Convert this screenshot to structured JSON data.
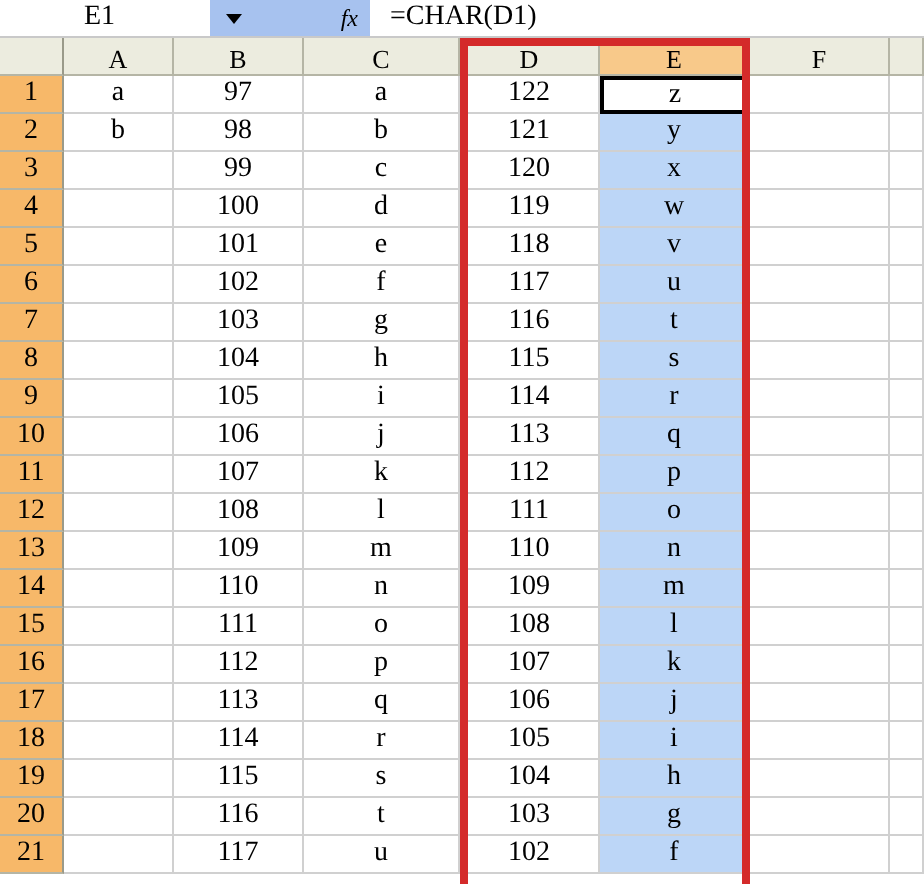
{
  "formula_bar": {
    "name_box": "E1",
    "fx": "fx",
    "formula": "=CHAR(D1)"
  },
  "columns": [
    {
      "label": "A",
      "selected": false,
      "outlined": false
    },
    {
      "label": "B",
      "selected": false,
      "outlined": false
    },
    {
      "label": "C",
      "selected": false,
      "outlined": false
    },
    {
      "label": "D",
      "selected": false,
      "outlined": true
    },
    {
      "label": "E",
      "selected": true,
      "outlined": true
    },
    {
      "label": "F",
      "selected": false,
      "outlined": false
    }
  ],
  "rows": [
    {
      "number": "1",
      "selected": true,
      "cells": [
        {
          "text": "a",
          "selected": false,
          "active": false
        },
        {
          "text": "97",
          "selected": false,
          "active": false
        },
        {
          "text": "a",
          "selected": false,
          "active": false
        },
        {
          "text": "122",
          "selected": false,
          "active": false
        },
        {
          "text": "z",
          "selected": false,
          "active": true
        },
        {
          "selected": false,
          "active": false
        }
      ]
    },
    {
      "number": "2",
      "selected": true,
      "cells": [
        {
          "text": "b",
          "selected": false,
          "active": false
        },
        {
          "text": "98",
          "selected": false,
          "active": false
        },
        {
          "text": "b",
          "selected": false,
          "active": false
        },
        {
          "text": "121",
          "selected": false,
          "active": false
        },
        {
          "text": "y",
          "selected": true,
          "active": false
        },
        {
          "selected": false,
          "active": false
        }
      ]
    },
    {
      "number": "3",
      "selected": true,
      "cells": [
        {
          "selected": false,
          "active": false
        },
        {
          "text": "99",
          "selected": false,
          "active": false
        },
        {
          "text": "c",
          "selected": false,
          "active": false
        },
        {
          "text": "120",
          "selected": false,
          "active": false
        },
        {
          "text": "x",
          "selected": true,
          "active": false
        },
        {
          "selected": false,
          "active": false
        }
      ]
    },
    {
      "number": "4",
      "selected": true,
      "cells": [
        {
          "selected": false,
          "active": false
        },
        {
          "text": "100",
          "selected": false,
          "active": false
        },
        {
          "text": "d",
          "selected": false,
          "active": false
        },
        {
          "text": "119",
          "selected": false,
          "active": false
        },
        {
          "text": "w",
          "selected": true,
          "active": false
        },
        {
          "selected": false,
          "active": false
        }
      ]
    },
    {
      "number": "5",
      "selected": true,
      "cells": [
        {
          "selected": false,
          "active": false
        },
        {
          "text": "101",
          "selected": false,
          "active": false
        },
        {
          "text": "e",
          "selected": false,
          "active": false
        },
        {
          "text": "118",
          "selected": false,
          "active": false
        },
        {
          "text": "v",
          "selected": true,
          "active": false
        },
        {
          "selected": false,
          "active": false
        }
      ]
    },
    {
      "number": "6",
      "selected": true,
      "cells": [
        {
          "selected": false,
          "active": false
        },
        {
          "text": "102",
          "selected": false,
          "active": false
        },
        {
          "text": "f",
          "selected": false,
          "active": false
        },
        {
          "text": "117",
          "selected": false,
          "active": false
        },
        {
          "text": "u",
          "selected": true,
          "active": false
        },
        {
          "selected": false,
          "active": false
        }
      ]
    },
    {
      "number": "7",
      "selected": true,
      "cells": [
        {
          "selected": false,
          "active": false
        },
        {
          "text": "103",
          "selected": false,
          "active": false
        },
        {
          "text": "g",
          "selected": false,
          "active": false
        },
        {
          "text": "116",
          "selected": false,
          "active": false
        },
        {
          "text": "t",
          "selected": true,
          "active": false
        },
        {
          "selected": false,
          "active": false
        }
      ]
    },
    {
      "number": "8",
      "selected": true,
      "cells": [
        {
          "selected": false,
          "active": false
        },
        {
          "text": "104",
          "selected": false,
          "active": false
        },
        {
          "text": "h",
          "selected": false,
          "active": false
        },
        {
          "text": "115",
          "selected": false,
          "active": false
        },
        {
          "text": "s",
          "selected": true,
          "active": false
        },
        {
          "selected": false,
          "active": false
        }
      ]
    },
    {
      "number": "9",
      "selected": true,
      "cells": [
        {
          "selected": false,
          "active": false
        },
        {
          "text": "105",
          "selected": false,
          "active": false
        },
        {
          "text": "i",
          "selected": false,
          "active": false
        },
        {
          "text": "114",
          "selected": false,
          "active": false
        },
        {
          "text": "r",
          "selected": true,
          "active": false
        },
        {
          "selected": false,
          "active": false
        }
      ]
    },
    {
      "number": "10",
      "selected": true,
      "cells": [
        {
          "selected": false,
          "active": false
        },
        {
          "text": "106",
          "selected": false,
          "active": false
        },
        {
          "text": "j",
          "selected": false,
          "active": false
        },
        {
          "text": "113",
          "selected": false,
          "active": false
        },
        {
          "text": "q",
          "selected": true,
          "active": false
        },
        {
          "selected": false,
          "active": false
        }
      ]
    },
    {
      "number": "11",
      "selected": true,
      "cells": [
        {
          "selected": false,
          "active": false
        },
        {
          "text": "107",
          "selected": false,
          "active": false
        },
        {
          "text": "k",
          "selected": false,
          "active": false
        },
        {
          "text": "112",
          "selected": false,
          "active": false
        },
        {
          "text": "p",
          "selected": true,
          "active": false
        },
        {
          "selected": false,
          "active": false
        }
      ]
    },
    {
      "number": "12",
      "selected": true,
      "cells": [
        {
          "selected": false,
          "active": false
        },
        {
          "text": "108",
          "selected": false,
          "active": false
        },
        {
          "text": "l",
          "selected": false,
          "active": false
        },
        {
          "text": "111",
          "selected": false,
          "active": false
        },
        {
          "text": "o",
          "selected": true,
          "active": false
        },
        {
          "selected": false,
          "active": false
        }
      ]
    },
    {
      "number": "13",
      "selected": true,
      "cells": [
        {
          "selected": false,
          "active": false
        },
        {
          "text": "109",
          "selected": false,
          "active": false
        },
        {
          "text": "m",
          "selected": false,
          "active": false
        },
        {
          "text": "110",
          "selected": false,
          "active": false
        },
        {
          "text": "n",
          "selected": true,
          "active": false
        },
        {
          "selected": false,
          "active": false
        }
      ]
    },
    {
      "number": "14",
      "selected": true,
      "cells": [
        {
          "selected": false,
          "active": false
        },
        {
          "text": "110",
          "selected": false,
          "active": false
        },
        {
          "text": "n",
          "selected": false,
          "active": false
        },
        {
          "text": "109",
          "selected": false,
          "active": false
        },
        {
          "text": "m",
          "selected": true,
          "active": false
        },
        {
          "selected": false,
          "active": false
        }
      ]
    },
    {
      "number": "15",
      "selected": true,
      "cells": [
        {
          "selected": false,
          "active": false
        },
        {
          "text": "111",
          "selected": false,
          "active": false
        },
        {
          "text": "o",
          "selected": false,
          "active": false
        },
        {
          "text": "108",
          "selected": false,
          "active": false
        },
        {
          "text": "l",
          "selected": true,
          "active": false
        },
        {
          "selected": false,
          "active": false
        }
      ]
    },
    {
      "number": "16",
      "selected": true,
      "cells": [
        {
          "selected": false,
          "active": false
        },
        {
          "text": "112",
          "selected": false,
          "active": false
        },
        {
          "text": "p",
          "selected": false,
          "active": false
        },
        {
          "text": "107",
          "selected": false,
          "active": false
        },
        {
          "text": "k",
          "selected": true,
          "active": false
        },
        {
          "selected": false,
          "active": false
        }
      ]
    },
    {
      "number": "17",
      "selected": true,
      "cells": [
        {
          "selected": false,
          "active": false
        },
        {
          "text": "113",
          "selected": false,
          "active": false
        },
        {
          "text": "q",
          "selected": false,
          "active": false
        },
        {
          "text": "106",
          "selected": false,
          "active": false
        },
        {
          "text": "j",
          "selected": true,
          "active": false
        },
        {
          "selected": false,
          "active": false
        }
      ]
    },
    {
      "number": "18",
      "selected": true,
      "cells": [
        {
          "selected": false,
          "active": false
        },
        {
          "text": "114",
          "selected": false,
          "active": false
        },
        {
          "text": "r",
          "selected": false,
          "active": false
        },
        {
          "text": "105",
          "selected": false,
          "active": false
        },
        {
          "text": "i",
          "selected": true,
          "active": false
        },
        {
          "selected": false,
          "active": false
        }
      ]
    },
    {
      "number": "19",
      "selected": true,
      "cells": [
        {
          "selected": false,
          "active": false
        },
        {
          "text": "115",
          "selected": false,
          "active": false
        },
        {
          "text": "s",
          "selected": false,
          "active": false
        },
        {
          "text": "104",
          "selected": false,
          "active": false
        },
        {
          "text": "h",
          "selected": true,
          "active": false
        },
        {
          "selected": false,
          "active": false
        }
      ]
    },
    {
      "number": "20",
      "selected": true,
      "cells": [
        {
          "selected": false,
          "active": false
        },
        {
          "text": "116",
          "selected": false,
          "active": false
        },
        {
          "text": "t",
          "selected": false,
          "active": false
        },
        {
          "text": "103",
          "selected": false,
          "active": false
        },
        {
          "text": "g",
          "selected": true,
          "active": false
        },
        {
          "selected": false,
          "active": false
        }
      ]
    },
    {
      "number": "21",
      "selected": true,
      "cells": [
        {
          "selected": false,
          "active": false
        },
        {
          "text": "117",
          "selected": false,
          "active": false
        },
        {
          "text": "u",
          "selected": false,
          "active": false
        },
        {
          "text": "102",
          "selected": false,
          "active": false
        },
        {
          "text": "f",
          "selected": true,
          "active": false
        },
        {
          "selected": false,
          "active": false
        }
      ]
    }
  ]
}
